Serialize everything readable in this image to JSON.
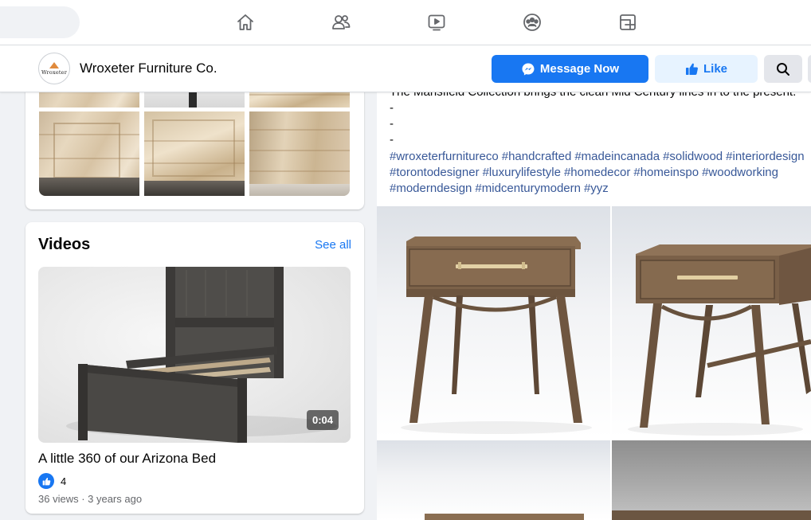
{
  "nav": {
    "icons": [
      "home-icon",
      "friends-icon",
      "watch-icon",
      "groups-icon",
      "gaming-icon"
    ]
  },
  "page": {
    "name": "Wroxeter Furniture Co.",
    "avatar_text": "Wroxeter",
    "message_label": "Message Now",
    "like_label": "Like"
  },
  "videos": {
    "title": "Videos",
    "see_all": "See all",
    "item": {
      "title": "A little 360 of our Arizona Bed",
      "duration": "0:04",
      "like_count": "4",
      "meta": "36 views · 3 years ago"
    }
  },
  "post": {
    "text_line": "The Mansfield Collection brings the clean Mid Century lines in to the present.",
    "dash_lines": [
      "-",
      "-",
      "-"
    ],
    "hashtags": [
      "#wroxeterfurnitureco",
      "#handcrafted",
      "#madeincanada",
      "#solidwood",
      "#interiordesign",
      "#torontodesigner",
      "#luxurylifestyle",
      "#homedecor",
      "#homeinspo",
      "#woodworking",
      "#moderndesign",
      "#midcenturymodern",
      "#yyz"
    ]
  },
  "colors": {
    "accent": "#1877f2",
    "like_bg": "#e7f3ff",
    "hashtag": "#385898",
    "background": "#f0f2f5"
  }
}
